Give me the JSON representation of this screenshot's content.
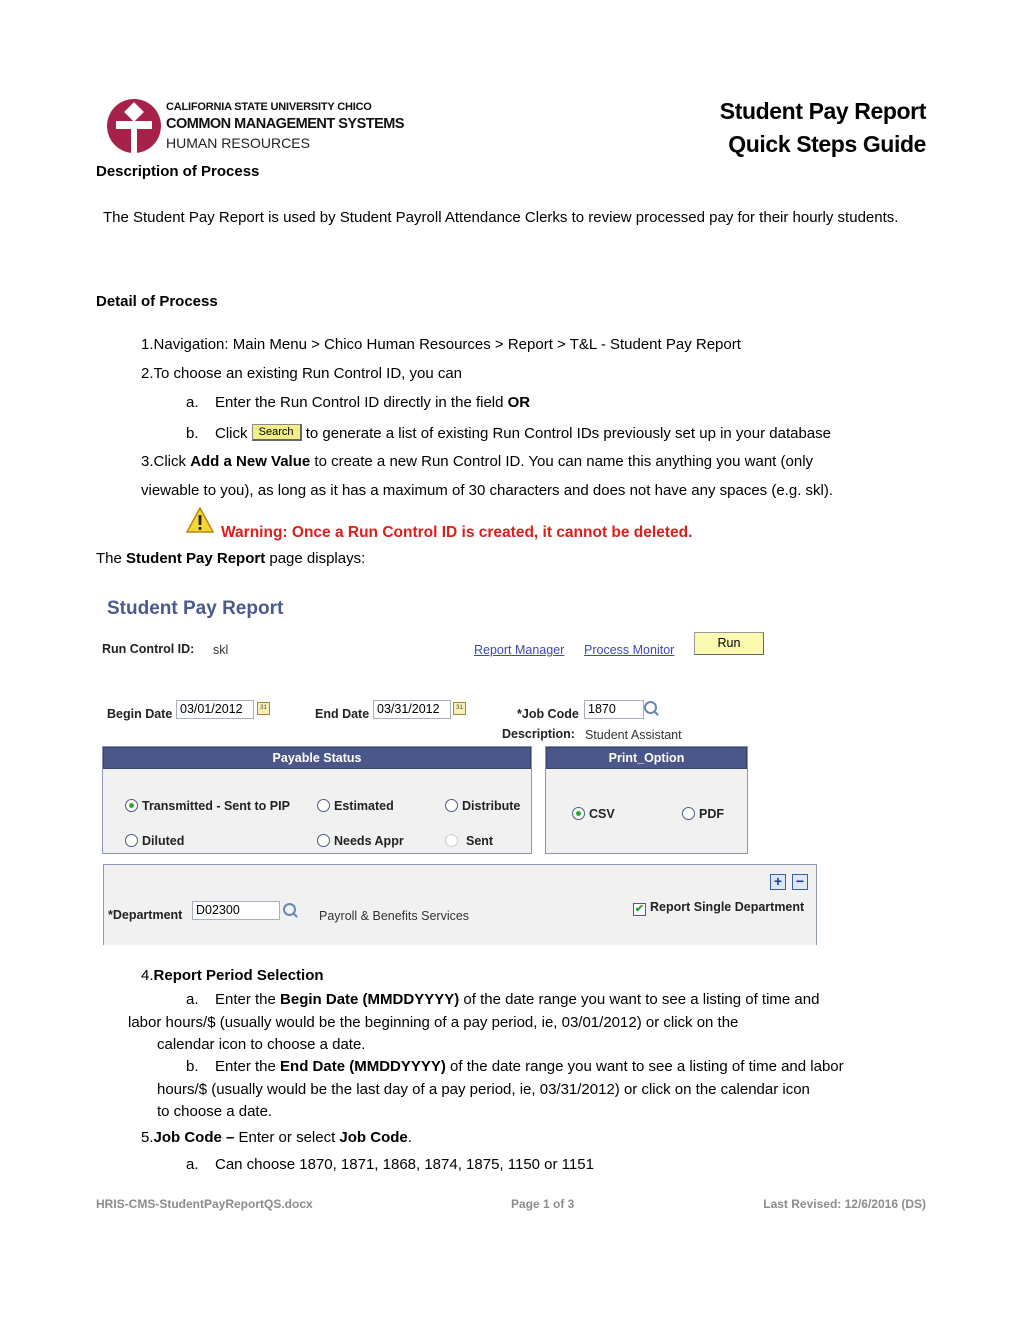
{
  "header": {
    "logo": {
      "line1": "CALIFORNIA STATE UNIVERSITY CHICO",
      "line2": "COMMON MANAGEMENT SYSTEMS",
      "line3": "HUMAN RESOURCES",
      "brand_color": "#a6224a"
    },
    "title_line1": "Student Pay Report",
    "title_line2": "Quick Steps Guide"
  },
  "description": {
    "heading": "Description of Process",
    "body": "The Student Pay Report is used by Student Payroll Attendance Clerks to review processed pay for their hourly students."
  },
  "detail": {
    "heading": "Detail of Process",
    "step1": {
      "num": "1.",
      "text": "Navigation: Main Menu > Chico Human Resources > Report > T&L - Student Pay Report"
    },
    "step2": {
      "num": "2.",
      "text": "To choose an existing Run Control ID, you can",
      "a": {
        "marker": "a.",
        "text": "Enter the Run Control ID directly in the field ",
        "bold": "OR"
      },
      "b": {
        "marker": "b.",
        "pre": "Click ",
        "button": "Search",
        "post": " to generate a list of existing Run Control IDs previously set up in your database"
      }
    },
    "step3": {
      "num": "3.",
      "pre": "Click ",
      "bold": "Add a New Value",
      "post1": " to create a new Run Control ID. You can name this anything you want (only",
      "post2": "viewable to you), as long as it has a maximum of 30 characters and does not have any spaces (e.g. skl)."
    },
    "warning": "Warning: Once a Run Control ID is created, it cannot be deleted.",
    "page_displays": {
      "pre": "The ",
      "bold": "Student Pay Report",
      "post": " page displays:"
    }
  },
  "screenshot": {
    "title": "Student Pay Report",
    "run_control_label": "Run Control ID:",
    "run_control_value": "skl",
    "report_manager": "Report Manager",
    "process_monitor": "Process Monitor",
    "run_button": "Run",
    "begin_date_label": "Begin Date",
    "begin_date_value": "03/01/2012",
    "end_date_label": "End Date",
    "end_date_value": "03/31/2012",
    "job_code_label": "*Job Code",
    "job_code_value": "1870",
    "description_label": "Description:",
    "description_value": "Student Assistant",
    "calendar_icon_text": "31",
    "payable_status": {
      "heading": "Payable Status",
      "options": [
        {
          "label": "Transmitted - Sent to PIP",
          "selected": true
        },
        {
          "label": "Estimated",
          "selected": false
        },
        {
          "label": "Distribute",
          "selected": false
        },
        {
          "label": "Diluted",
          "selected": false
        },
        {
          "label": "Needs Appr",
          "selected": false
        },
        {
          "label": "Sent",
          "selected": false,
          "disabled": true
        }
      ]
    },
    "print_option": {
      "heading": "Print_Option",
      "options": [
        {
          "label": "CSV",
          "selected": true
        },
        {
          "label": "PDF",
          "selected": false
        }
      ]
    },
    "department_label": "*Department",
    "department_value": "D02300",
    "department_desc": "Payroll & Benefits Services",
    "add_row": "+",
    "delete_row": "−",
    "report_single_dept_label": "Report Single Department",
    "report_single_dept_checked": true
  },
  "steps_continued": {
    "step4": {
      "num": "4.",
      "heading": "Report Period Selection",
      "a": {
        "marker": "a.",
        "pre": "Enter the ",
        "bold": "Begin Date (MMDDYYYY)",
        "line1": " of the date range you want to see a listing of time and",
        "line2": "labor hours/$ (usually would be the beginning of a pay period, ie, 03/01/2012) or click on the",
        "line3": "calendar icon to choose a date."
      },
      "b": {
        "marker": "b.",
        "pre": "Enter the ",
        "bold": "End Date (MMDDYYYY)",
        "line1": " of the date range you want to see a listing of time and labor",
        "line2": "hours/$ (usually would be the last day of a pay period, ie, 03/31/2012) or click on the calendar icon",
        "line3": "to choose a date."
      }
    },
    "step5": {
      "num": "5.",
      "bold1": "Job Code –",
      "mid": " Enter or select ",
      "bold2": "Job Code",
      "end": ".",
      "a": {
        "marker": "a.",
        "text": "Can choose 1870, 1871, 1868, 1874, 1875, 1150 or 1151"
      }
    }
  },
  "footer": {
    "filename": "HRIS-CMS-StudentPayReportQS.docx",
    "page": "Page 1 of 3",
    "revised": "Last Revised: 12/6/2016 (DS)"
  }
}
